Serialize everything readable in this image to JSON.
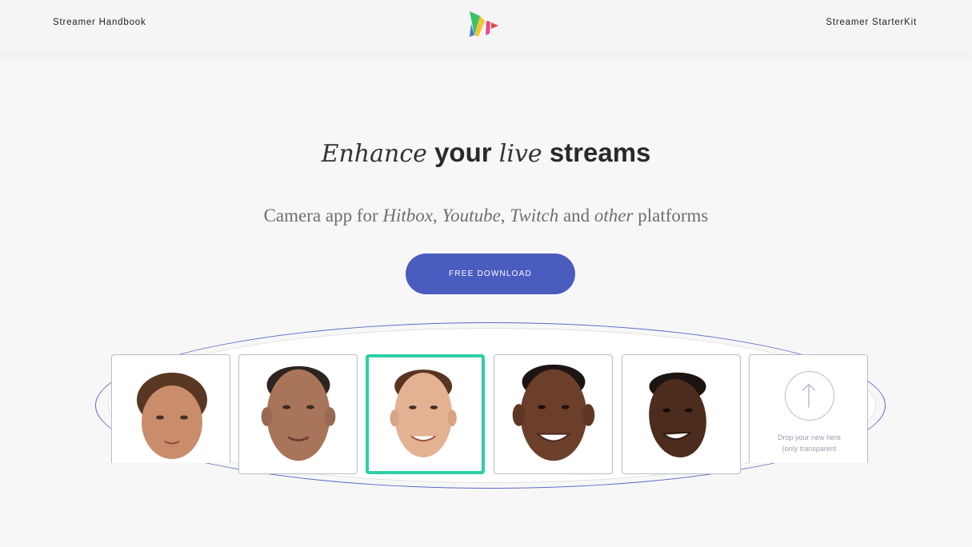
{
  "nav": {
    "left_link": "Streamer Handbook",
    "right_link": "Streamer StarterKit",
    "logo_icon": "app-logo-icon"
  },
  "hero": {
    "headline": {
      "word1": "Enhance",
      "word2": "your",
      "word3": "live",
      "word4": "streams"
    },
    "subline": {
      "part1": "Camera app for ",
      "platform1": "Hitbox",
      "sep1": ", ",
      "platform2": "Youtube",
      "sep2": ", ",
      "platform3": "Twitch",
      "part2": " and ",
      "other": "other",
      "part3": " platforms"
    },
    "cta_label": "FREE DOWNLOAD"
  },
  "mask_picker": {
    "faces": [
      {
        "id": "face-1",
        "selected": false
      },
      {
        "id": "face-2",
        "selected": false
      },
      {
        "id": "face-3",
        "selected": true
      },
      {
        "id": "face-4",
        "selected": false
      },
      {
        "id": "face-5",
        "selected": false
      }
    ],
    "drop_card": {
      "line1": "Drop your new here",
      "line2": "(only transparent"
    }
  },
  "colors": {
    "accent": "#4b5cbf",
    "selected_border": "#2fcfa7",
    "ellipse": "#5b6bc7"
  }
}
